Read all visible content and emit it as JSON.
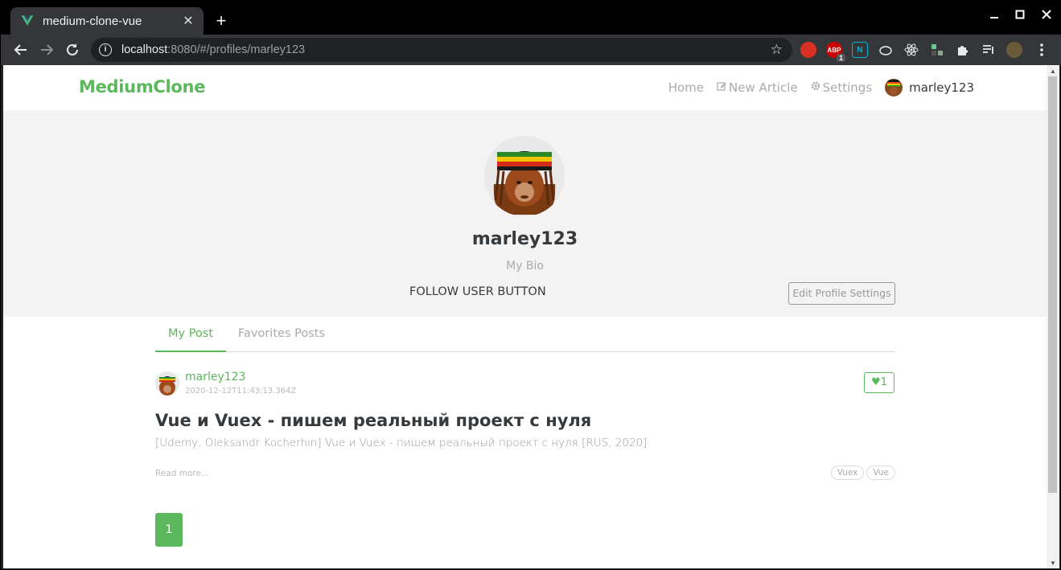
{
  "browser": {
    "tab_title": "medium-clone-vue",
    "tab_close_glyph": "✕",
    "new_tab_glyph": "+",
    "url_host": "localhost",
    "url_path": ":8080/#/profiles/marley123",
    "extensions": [
      "santa-hat-icon",
      "adblock-icon",
      "n-icon",
      "cloud-icon",
      "react-icon",
      "pixel-icon",
      "puzzle-icon",
      "queue-icon",
      "profile-icon",
      "menu-icon"
    ],
    "adblock_badge": "1",
    "adblock_label": "ABP",
    "n_label": "N"
  },
  "nav": {
    "brand": "MediumClone",
    "home": "Home",
    "new_article": "New Article",
    "settings": "Settings",
    "username": "marley123"
  },
  "profile": {
    "username": "marley123",
    "bio": "My Bio",
    "follow_text": "FOLLOW USER BUTTON",
    "edit_button": "Edit Profile Settings"
  },
  "tabs": {
    "my_posts": "My Post",
    "favorites": "Favorites Posts"
  },
  "article": {
    "author": "marley123",
    "date": "2020-12-12T11:43:13.364Z",
    "favorites_count": "1",
    "title": "Vue и Vuex - пишем реальный проект с нуля",
    "description": "[Udemy, Oleksandr Kocherhin] Vue и Vuex - пишем реальный проект с нуля [RUS, 2020]",
    "read_more": "Read more...",
    "tags": [
      "Vuex",
      "Vue"
    ]
  },
  "pagination": {
    "current_page": "1"
  },
  "colors": {
    "brand": "#5cb85c",
    "banner_bg": "#f3f3f3"
  }
}
